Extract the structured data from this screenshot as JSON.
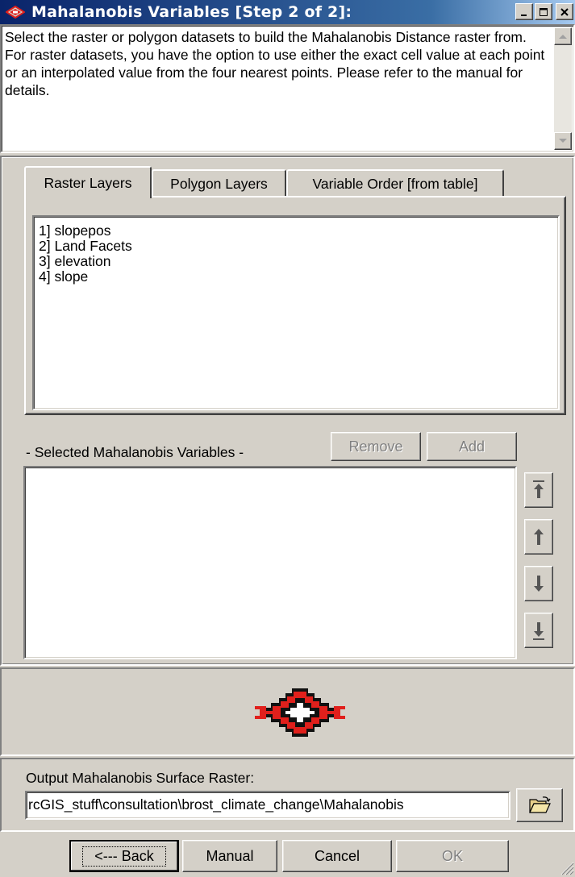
{
  "window": {
    "title": "Mahalanobis Variables [Step 2 of 2]:",
    "icon": "red-eye-icon",
    "controls": [
      "minimize-icon",
      "maximize-icon",
      "close-icon"
    ]
  },
  "description": "Select the raster or polygon datasets to build the Mahalanobis Distance raster from. For raster datasets, you have the option to use either the exact cell value at each point or an interpolated value from the four nearest points.  Please refer to the manual for details.",
  "tabs": [
    {
      "label": "Raster Layers",
      "active": true
    },
    {
      "label": "Polygon Layers",
      "active": false
    },
    {
      "label": "Variable Order [from table]",
      "active": false
    }
  ],
  "raster_layers": [
    "1] slopepos",
    "2] Land Facets",
    "3] elevation",
    "4] slope"
  ],
  "selected": {
    "label": "- Selected Mahalanobis Variables -",
    "remove_label": "Remove",
    "add_label": "Add",
    "items": []
  },
  "order_buttons": [
    "move-top-icon",
    "move-up-icon",
    "move-down-icon",
    "move-bottom-icon"
  ],
  "logo": "southwest-logo",
  "output": {
    "label": "Output Mahalanobis Surface Raster:",
    "value": "rcGIS_stuff\\consultation\\brost_climate_change\\Mahalanobis",
    "browse_icon": "open-folder-icon"
  },
  "footer": {
    "back_label": "<--- Back",
    "manual_label": "Manual",
    "cancel_label": "Cancel",
    "ok_label": "OK"
  },
  "colors": {
    "titlebar_start": "#0a246a",
    "titlebar_end": "#a6caf0",
    "face": "#d4d0c8",
    "logo_red": "#e0201c"
  }
}
